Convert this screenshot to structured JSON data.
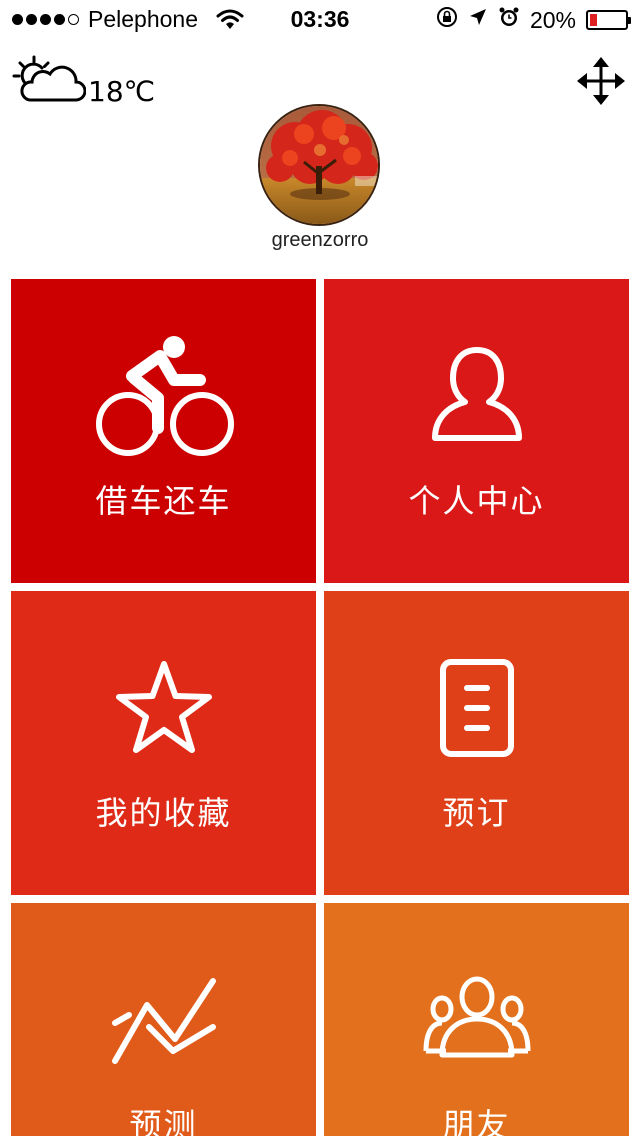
{
  "status_bar": {
    "carrier": "Pelephone",
    "time": "03:36",
    "battery": "20%",
    "battery_level": 0.2
  },
  "header": {
    "temperature": "18℃",
    "weather_icon": "partly-cloudy-icon",
    "move_icon": "move-arrows-icon",
    "username": "greenzorro"
  },
  "tiles": [
    {
      "label": "借车还车",
      "icon": "bicycle-rider-icon",
      "color": "#cc0000"
    },
    {
      "label": "个人中心",
      "icon": "user-icon",
      "color": "#da1818"
    },
    {
      "label": "我的收藏",
      "icon": "star-icon",
      "color": "#df2a18"
    },
    {
      "label": "预订",
      "icon": "document-list-icon",
      "color": "#df4018"
    },
    {
      "label": "预测",
      "icon": "trend-icon",
      "color": "#e05a1a"
    },
    {
      "label": "朋友",
      "icon": "group-icon",
      "color": "#e2701c"
    }
  ]
}
